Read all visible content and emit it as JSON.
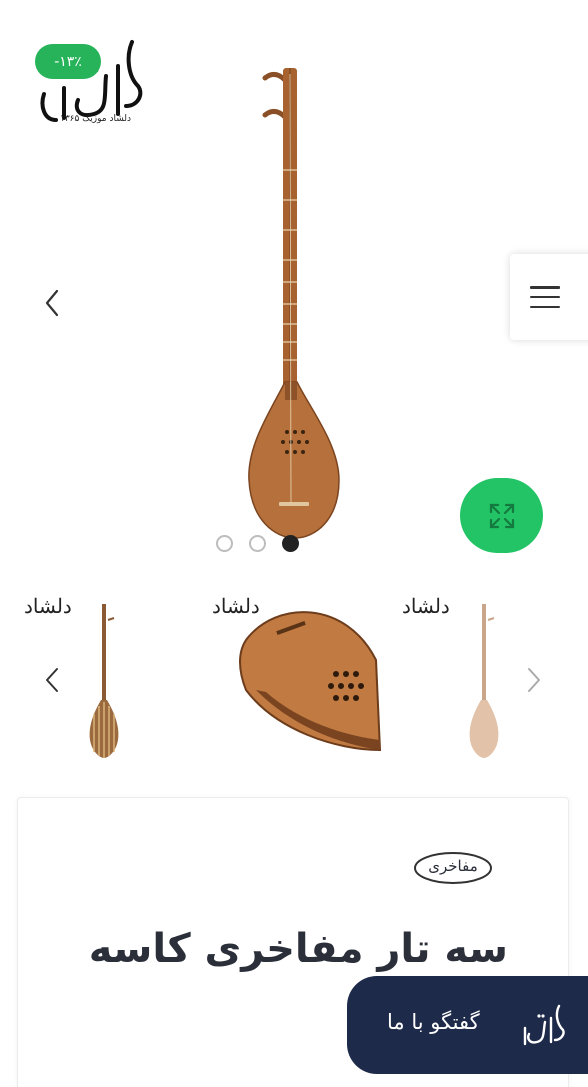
{
  "gallery": {
    "discount_badge": "-۱۳٪",
    "logo_caption": "دلشاد موزیک ۱۳۶۵",
    "logo_text": "دلشاد",
    "slides_count": 3,
    "active_slide": 3
  },
  "thumbnails": {
    "items": [
      {
        "logo": "دلشاد",
        "kind": "full-instrument-striped"
      },
      {
        "logo": "دلشاد",
        "kind": "bowl-closeup"
      },
      {
        "logo": "دلشاد",
        "kind": "full-instrument-light"
      }
    ]
  },
  "product": {
    "brand_badge": "مفاخری",
    "title": "سه تار مفاخری کاسه"
  },
  "chat": {
    "label": "گفتگو با ما",
    "logo_text": "دلشاد"
  },
  "colors": {
    "green": "#27b35a",
    "zoom_green": "#22c466",
    "navy": "#1e2a4a",
    "wood": "#b5703b"
  }
}
